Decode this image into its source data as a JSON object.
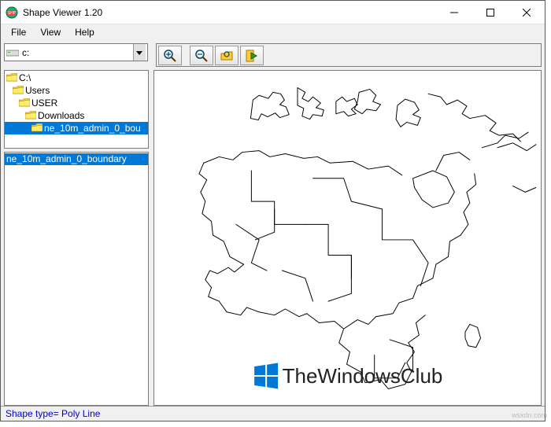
{
  "window": {
    "title": "Shape Viewer 1.20"
  },
  "menu": {
    "file": "File",
    "view": "View",
    "help": "Help"
  },
  "drive": {
    "label": "c:"
  },
  "tree": {
    "n0": "C:\\",
    "n1": "Users",
    "n2": "USER",
    "n3": "Downloads",
    "n4": "ne_10m_admin_0_bou"
  },
  "file_list": {
    "item0": "ne_10m_admin_0_boundary"
  },
  "watermark": {
    "text": "TheWindowsClub"
  },
  "status": {
    "text": "Shape type= Poly Line"
  },
  "attribution": "wsxdn.com"
}
